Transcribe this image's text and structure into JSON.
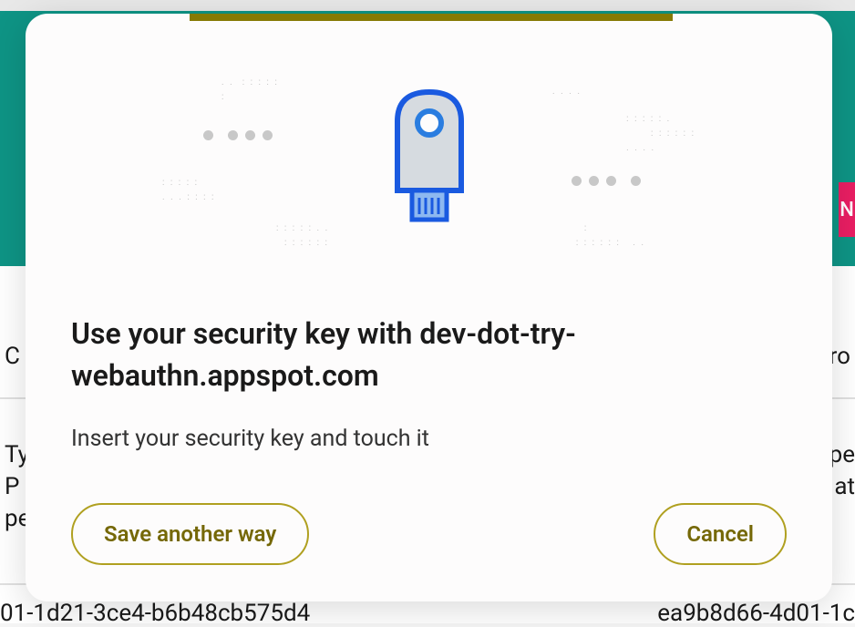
{
  "backdrop": {
    "sideTextLeft1": "C",
    "sideTextRight1": "ro",
    "sideTextLeft2a": "Ty",
    "sideTextLeft2b": "P",
    "sideTextLeft2c": "pe",
    "sideTextRight2a": "pe",
    "sideTextRight2b": "at",
    "bottomTextLeft": "01-1d21-3ce4-b6b48cb575d4",
    "bottomTextRight": "ea9b8d66-4d01-1c",
    "pinkLabel": "N"
  },
  "dialog": {
    "title": "Use your security key with dev-dot-try-webauthn.appspot.com",
    "subtitle": "Insert your security key and touch it",
    "saveAnotherWayLabel": "Save another way",
    "cancelLabel": "Cancel"
  }
}
